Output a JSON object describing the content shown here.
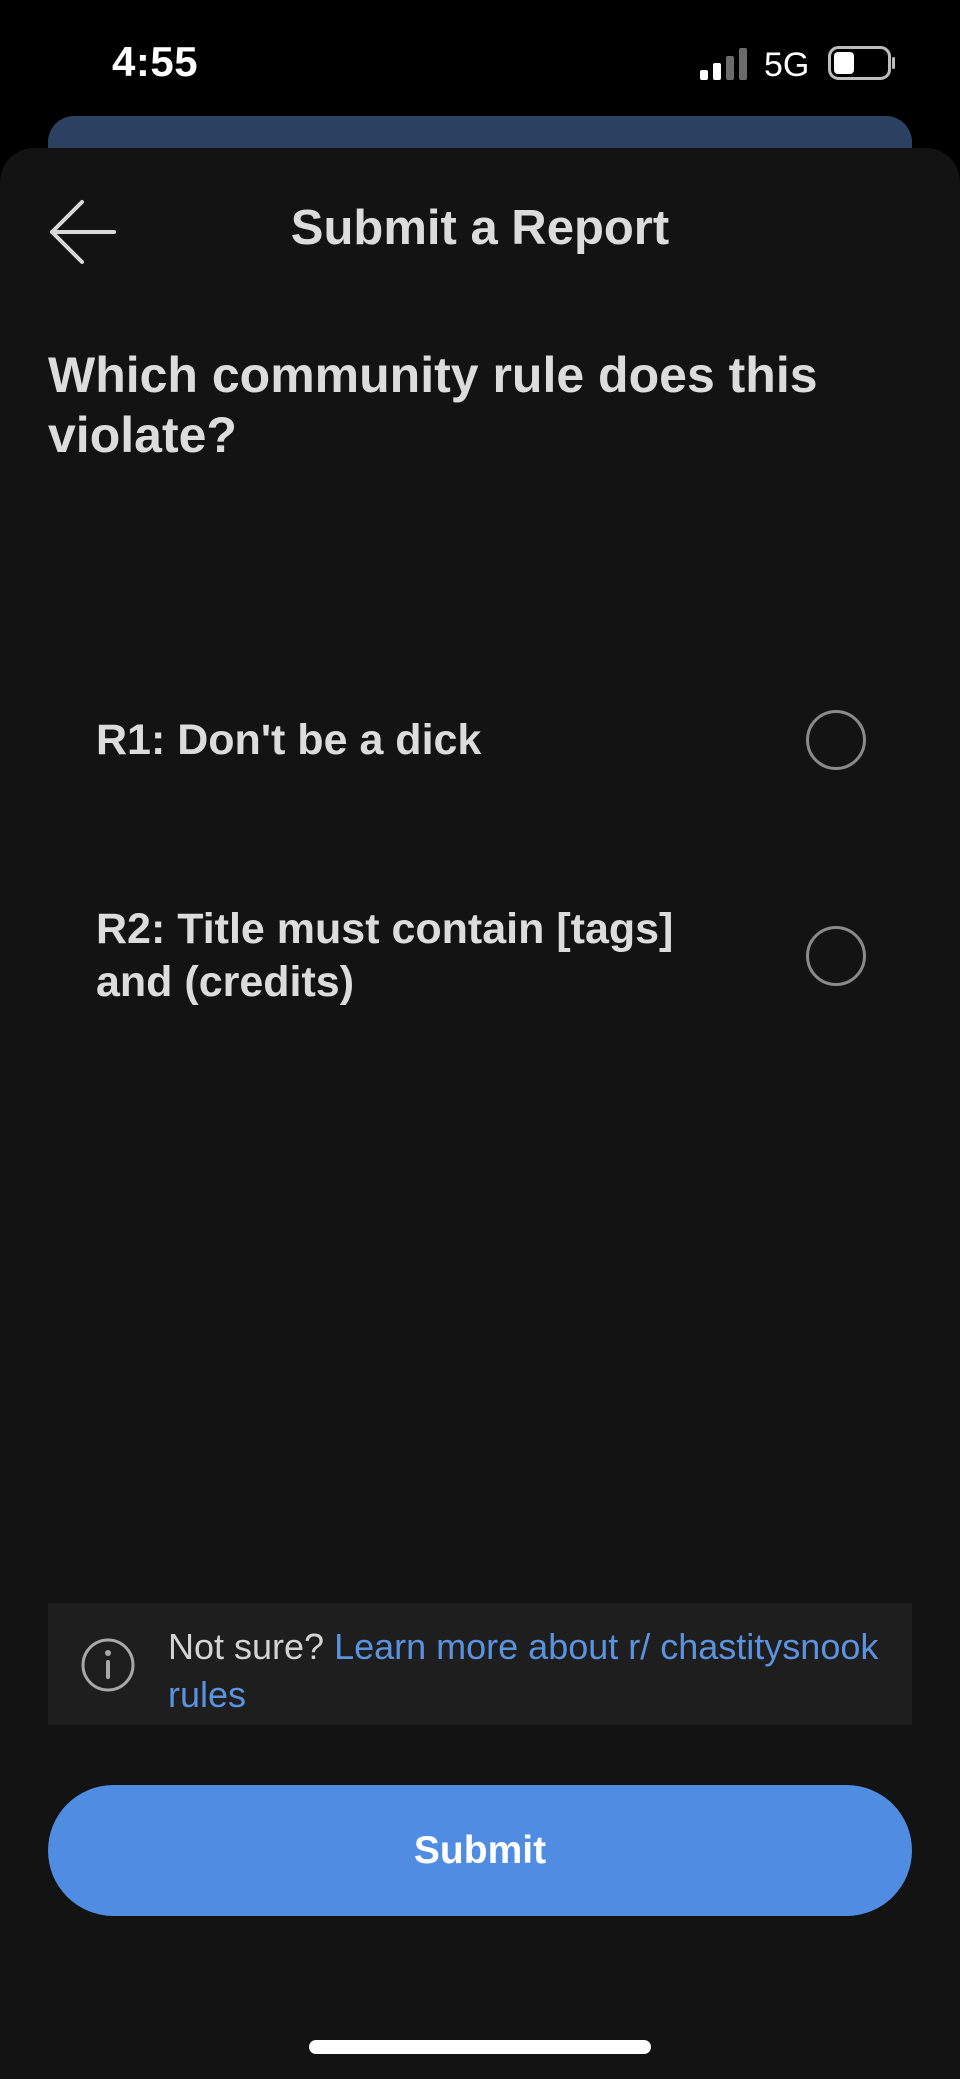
{
  "status_bar": {
    "time": "4:55",
    "network": "5G",
    "signal_icon": "signal-bars-icon",
    "battery_icon": "battery-icon"
  },
  "header": {
    "title": "Submit a Report",
    "back_icon": "back-arrow-icon"
  },
  "question": "Which community rule does this violate?",
  "rules": [
    {
      "label": "R1: Don't be a dick",
      "selected": false
    },
    {
      "label": "R2: Title must contain [tags] and (credits)",
      "selected": false
    }
  ],
  "info": {
    "icon": "info-icon",
    "prefix": "Not sure? ",
    "link": "Learn more about r/ chastitysnook rules"
  },
  "submit_label": "Submit",
  "colors": {
    "background": "#131313",
    "accent": "#4f8ce2",
    "link": "#5b93e0",
    "text": "#dcdcdc"
  }
}
